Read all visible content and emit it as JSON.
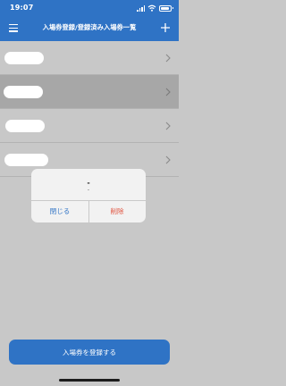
{
  "status_bar": {
    "time": "19:07"
  },
  "header": {
    "title": "入場券登録/登録済み入場券一覧"
  },
  "list": {
    "items": [
      {
        "label": ""
      },
      {
        "label": ""
      },
      {
        "label": ""
      },
      {
        "label": ""
      }
    ]
  },
  "dialog": {
    "title": "-",
    "message": "-",
    "close_label": "閉じる",
    "delete_label": "削除"
  },
  "footer": {
    "register_label": "入場券を登録する"
  },
  "colors": {
    "accent": "#2f73c5",
    "destructive": "#e0533f",
    "overlay": "#c8c8c8"
  }
}
